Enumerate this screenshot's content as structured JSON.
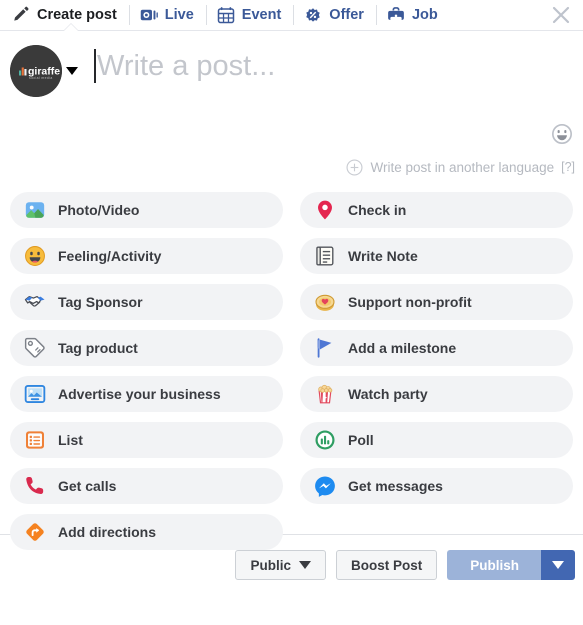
{
  "window": {
    "close_label": "close-icon"
  },
  "tabs": [
    {
      "label": "Create post",
      "icon": "pencil-icon",
      "active": true
    },
    {
      "label": "Live",
      "icon": "live-video-icon",
      "active": false
    },
    {
      "label": "Event",
      "icon": "calendar-icon",
      "active": false
    },
    {
      "label": "Offer",
      "icon": "percent-badge-icon",
      "active": false
    },
    {
      "label": "Job",
      "icon": "briefcase-icon",
      "active": false
    }
  ],
  "composer": {
    "avatar_name": "giraffe",
    "avatar_subtitle": "social media",
    "placeholder": "Write a post...",
    "value": "",
    "emoji_icon": "smiley-icon",
    "audience_caret": "chevron-down-icon"
  },
  "language": {
    "add_icon": "plus-circle-icon",
    "label": "Write post in another language",
    "help": "[?]"
  },
  "options_left": [
    {
      "label": "Photo/Video",
      "icon": "photo-video-icon"
    },
    {
      "label": "Feeling/Activity",
      "icon": "smiley-yellow-icon"
    },
    {
      "label": "Tag Sponsor",
      "icon": "handshake-icon"
    },
    {
      "label": "Tag product",
      "icon": "price-tag-icon"
    },
    {
      "label": "Advertise your business",
      "icon": "advertise-icon"
    },
    {
      "label": "List",
      "icon": "list-icon"
    },
    {
      "label": "Get calls",
      "icon": "phone-icon"
    },
    {
      "label": "Add directions",
      "icon": "directions-icon"
    }
  ],
  "options_right": [
    {
      "label": "Check in",
      "icon": "location-pin-icon"
    },
    {
      "label": "Write Note",
      "icon": "notebook-icon"
    },
    {
      "label": "Support non-profit",
      "icon": "donation-heart-icon"
    },
    {
      "label": "Add a milestone",
      "icon": "flag-icon"
    },
    {
      "label": "Watch party",
      "icon": "popcorn-icon"
    },
    {
      "label": "Poll",
      "icon": "poll-bars-icon"
    },
    {
      "label": "Get messages",
      "icon": "messenger-icon"
    }
  ],
  "footer": {
    "audience_label": "Public",
    "boost_label": "Boost Post",
    "publish_label": "Publish",
    "publish_caret": "chevron-down-icon"
  },
  "colors": {
    "facebook_blue": "#3b5998",
    "publish_disabled": "#9cb3d9",
    "publish_caret_bg": "#4267b2",
    "pill_bg": "#f2f3f5",
    "placeholder_grey": "#c3c6cc"
  }
}
